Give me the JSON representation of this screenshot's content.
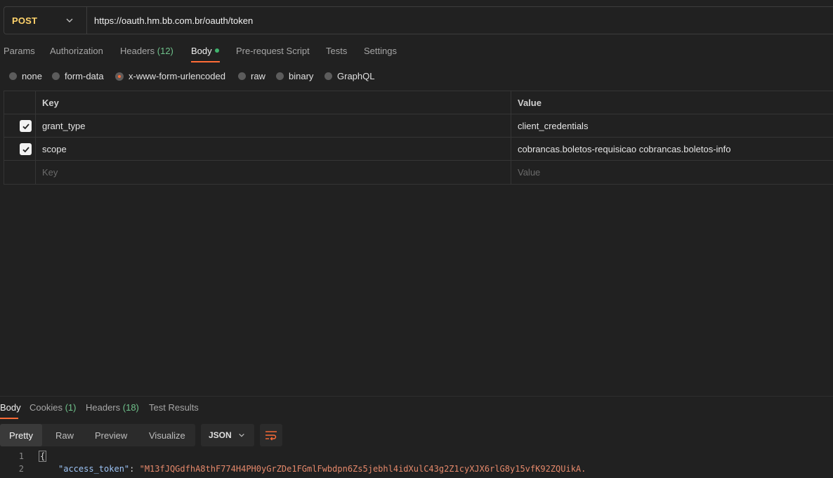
{
  "request": {
    "method": "POST",
    "url": "https://oauth.hm.bb.com.br/oauth/token"
  },
  "tabs": [
    {
      "label": "Params"
    },
    {
      "label": "Authorization"
    },
    {
      "label": "Headers",
      "count": "(12)"
    },
    {
      "label": "Body"
    },
    {
      "label": "Pre-request Script"
    },
    {
      "label": "Tests"
    },
    {
      "label": "Settings"
    }
  ],
  "body_modes": [
    {
      "label": "none"
    },
    {
      "label": "form-data"
    },
    {
      "label": "x-www-form-urlencoded"
    },
    {
      "label": "raw"
    },
    {
      "label": "binary"
    },
    {
      "label": "GraphQL"
    }
  ],
  "table": {
    "key_header": "Key",
    "value_header": "Value",
    "rows": [
      {
        "key": "grant_type",
        "value": "client_credentials"
      },
      {
        "key": "scope",
        "value": "cobrancas.boletos-requisicao cobrancas.boletos-info"
      }
    ],
    "key_placeholder": "Key",
    "value_placeholder": "Value"
  },
  "response": {
    "tabs": [
      {
        "label": "Body"
      },
      {
        "label": "Cookies",
        "count": "(1)"
      },
      {
        "label": "Headers",
        "count": "(18)"
      },
      {
        "label": "Test Results"
      }
    ],
    "views": [
      "Pretty",
      "Raw",
      "Preview",
      "Visualize"
    ],
    "format": "JSON",
    "lines": [
      {
        "num": "1",
        "text": "{"
      },
      {
        "num": "2",
        "key": "\"access_token\"",
        "sep": ": ",
        "value": "\"M13fJQGdfhA8thF774H4PH0yGrZDe1FGmlFwbdpn6Zs5jebhl4idXulC43g2Z1cyXJX6rlG8y15vfK92ZQUikA."
      }
    ]
  },
  "colors": {
    "accent": "#ff6c37",
    "method": "#ffd36b",
    "count": "#6fc28b",
    "json_key": "#9cc3f5",
    "json_string": "#e6896b"
  }
}
